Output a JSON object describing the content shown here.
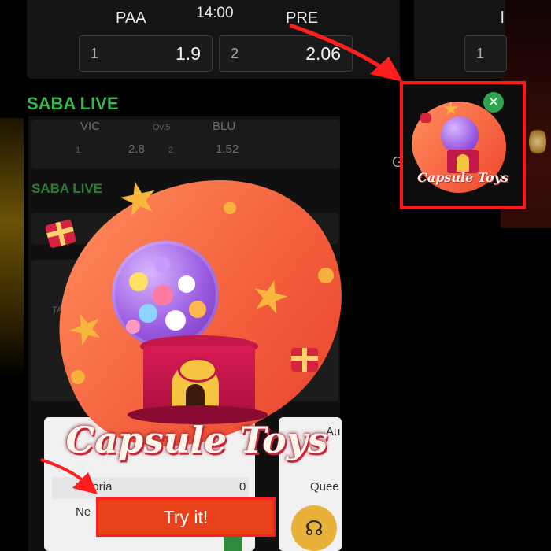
{
  "match": {
    "home": "PAA",
    "time": "14:00",
    "away": "PRE",
    "odds": [
      {
        "index": "1",
        "value": "1.9"
      },
      {
        "index": "2",
        "value": "2.06"
      }
    ],
    "right_partial_team": "l",
    "right_partial_index": "1"
  },
  "saba_live": "SABA LIVE",
  "background_app": {
    "match": {
      "home": "VIC",
      "mid": "Ov.5",
      "away": "BLU",
      "idx1": "1",
      "val1": "2.8",
      "idx2": "2",
      "val2": "1.52"
    },
    "saba_live": "SABA LIVE",
    "peek_letter": "G",
    "tab_label": "TA",
    "rows": [
      {
        "team": "Vittoria",
        "score": "0"
      },
      {
        "team": "Ne",
        "score": ""
      }
    ],
    "right_peek": {
      "top": "Au",
      "team": "Quee"
    }
  },
  "promo": {
    "title": "Capsule Toys",
    "cta_label": "Try it!"
  },
  "thumbnail": {
    "title": "Capsule Toys",
    "close_glyph": "✕"
  },
  "colors": {
    "accent_green": "#39b54a",
    "cta_orange": "#e8421a",
    "highlight_red": "#ff1616"
  }
}
